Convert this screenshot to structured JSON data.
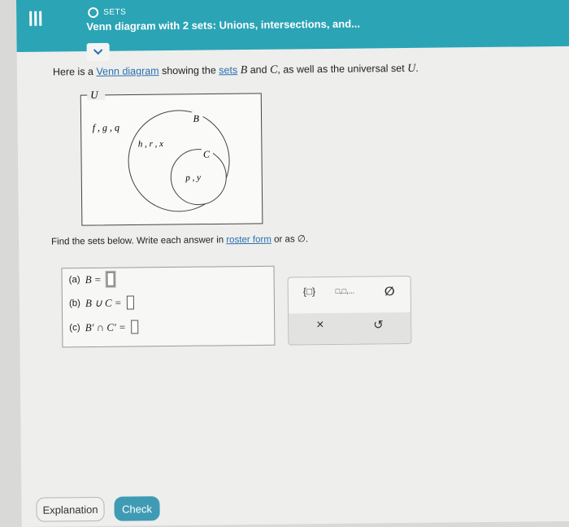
{
  "header": {
    "topic": "SETS",
    "title": "Venn diagram with 2 sets: Unions, intersections, and..."
  },
  "intro": {
    "prefix": "Here is a ",
    "venn_link": "Venn diagram",
    "mid1": " showing the ",
    "sets_link": "sets",
    "set_b": "B",
    "mid2": " and ",
    "set_c": "C",
    "mid3": ", as well as the universal set ",
    "set_u": "U",
    "suffix": "."
  },
  "venn": {
    "universal_label": "U",
    "b_label": "B",
    "c_label": "C",
    "outside": "f , g , q",
    "b_only": "h , r , x",
    "c_region": "p , y"
  },
  "instructions": {
    "text": "Find the sets below. Write each answer in ",
    "roster_link": "roster form",
    "or_text": " or as ",
    "empty_set": "∅",
    "end": "."
  },
  "questions": [
    {
      "label": "(a)",
      "expr": "B ="
    },
    {
      "label": "(b)",
      "expr": "B ∪ C ="
    },
    {
      "label": "(c)",
      "expr": "B′  ∩ C′  ="
    }
  ],
  "toolbar": {
    "braces": "{□}",
    "list": "□,□,...",
    "empty_set": "∅",
    "clear": "×",
    "undo": "↺"
  },
  "buttons": {
    "explanation": "Explanation",
    "check": "Check"
  },
  "colors": {
    "header": "#2ba4b6",
    "check_button": "#3f9bb4",
    "link": "#2a6fb0"
  }
}
